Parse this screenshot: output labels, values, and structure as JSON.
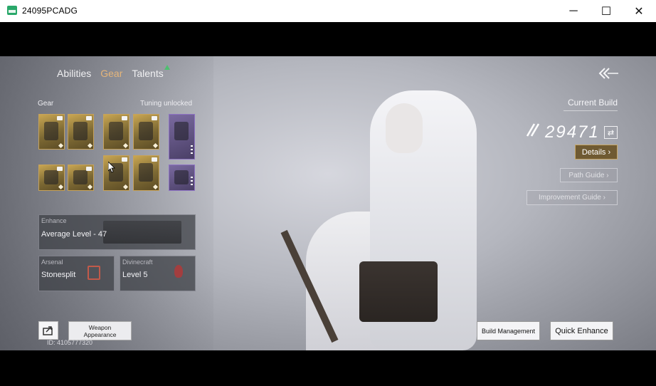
{
  "window": {
    "title": "24095PCADG",
    "minimize_glyph": "─",
    "maximize_glyph": "☐",
    "close_glyph": "✕"
  },
  "tabs": [
    {
      "label": "Abilities",
      "active": false
    },
    {
      "label": "Gear",
      "active": true
    },
    {
      "label": "Talents",
      "active": false
    }
  ],
  "gear": {
    "header": "Gear",
    "tuning_label": "Tuning unlocked",
    "slots_row1": [
      "weapon-1",
      "weapon-2",
      "armor-1",
      "armor-2"
    ],
    "slots_row2": [
      "ring",
      "dagger",
      "armor-3",
      "armor-4"
    ],
    "extra_slots": [
      "bow",
      "accessory-ring"
    ]
  },
  "enhance": {
    "label": "Enhance",
    "value": "Average Level - 47"
  },
  "arsenal": {
    "label": "Arsenal",
    "value": "Stonesplit"
  },
  "divinecraft": {
    "label": "Divinecraft",
    "value": "Level 5"
  },
  "bottom_left": {
    "weapon_appearance_line1": "Weapon",
    "weapon_appearance_line2": "Appearance",
    "id_text": "ID: 4105777320"
  },
  "build": {
    "current_build_label": "Current Build",
    "score": "29471",
    "details_label": "Details",
    "path_guide_label": "Path Guide",
    "improvement_guide_label": "Improvement Guide",
    "build_management_label": "Build Management",
    "quick_enhance_label": "Quick Enhance"
  },
  "icons": {
    "back": "back-arrows-icon",
    "share": "share-icon",
    "swap": "swap-icon",
    "score": "combat-power-icon"
  },
  "colors": {
    "active_tab": "#e5b57a",
    "details_button": "#6f5a32",
    "gold_border": "#c7a869",
    "talent_indicator": "#4fbf70"
  }
}
